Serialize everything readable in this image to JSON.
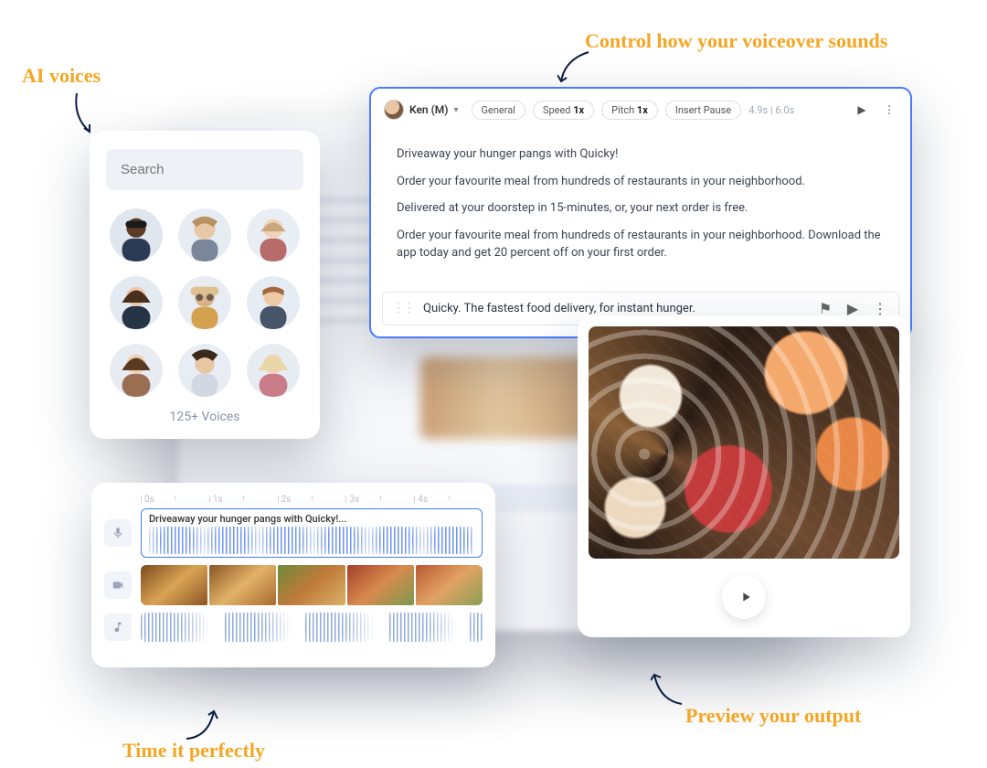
{
  "annotations": {
    "voices": "AI voices",
    "control": "Control how your voiceover sounds",
    "timeline": "Time it perfectly",
    "preview": "Preview your output"
  },
  "voices_panel": {
    "search_placeholder": "Search",
    "count_label": "125+ Voices"
  },
  "editor": {
    "voice_name": "Ken (M)",
    "chip_general": "General",
    "chip_speed_prefix": "Speed ",
    "chip_speed_value": "1x",
    "chip_pitch_prefix": "Pitch ",
    "chip_pitch_value": "1x",
    "chip_pause": "Insert Pause",
    "time_readout": "4.9s | 6.0s",
    "p1": "Driveaway your hunger pangs with Quicky!",
    "p2": "Order your favourite meal from hundreds of restaurants in your neighborhood.",
    "p3": "Delivered at your doorstep in 15-minutes, or, your next order is free.",
    "p4": "Order your favourite meal from hundreds of restaurants in your neighborhood. Download the app today and get 20 percent off on your first order.",
    "current_line": "Quicky. The fastest food delivery, for instant hunger."
  },
  "timeline": {
    "ticks": [
      "0s",
      "1s",
      "2s",
      "3s",
      "4s"
    ],
    "clip_label": "Driveaway your hunger pangs with Quicky!..."
  }
}
